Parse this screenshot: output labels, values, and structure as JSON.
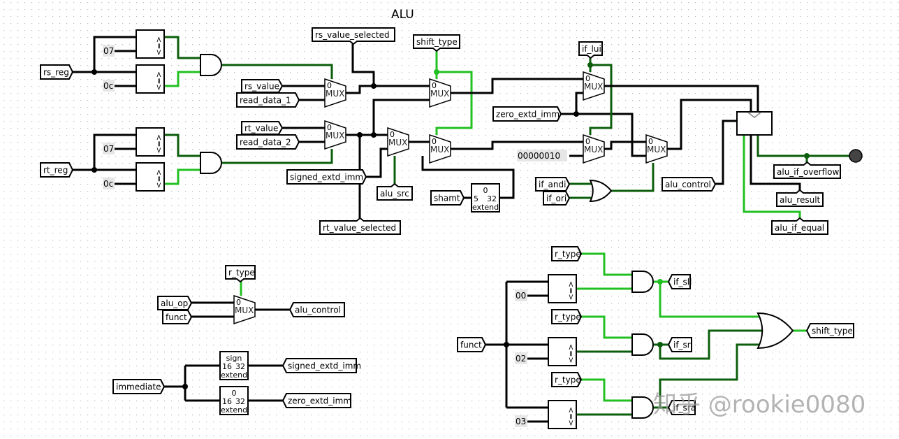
{
  "title": "ALU",
  "labels": {
    "rs_reg": "rs_reg",
    "rt_reg": "rt_reg",
    "rs_value": "rs_value",
    "read_data_1": "read_data_1",
    "rt_value": "rt_value",
    "read_data_2": "read_data_2",
    "rs_value_selected": "rs_value_selected",
    "rt_value_selected": "rt_value_selected",
    "shift_type": "shift_type",
    "signed_extd_imm": "signed_extd_imm",
    "alu_src": "alu_src",
    "shamt": "shamt",
    "if_lui": "if_lui",
    "zero_extd_imm": "zero_extd_imm",
    "if_andi": "if_andi",
    "if_ori": "if_ori",
    "alu_control": "alu_control",
    "alu_if_overflow": "alu_if_overflow",
    "alu_result": "alu_result",
    "alu_if_equal": "alu_if_equal",
    "r_type": "r_type",
    "alu_op": "alu_op",
    "funct": "funct",
    "immediate": "immediate",
    "if_sll": "if_sll",
    "if_srl": "if_srl",
    "if_sra": "if_sra"
  },
  "constants": {
    "c07": "07",
    "c0c": "0c",
    "c00": "00",
    "c02": "02",
    "c03": "03",
    "c10": "00000010"
  },
  "components": {
    "mux": "MUX",
    "mux_sel": "0",
    "comparator": "<=>",
    "extend": "extend",
    "sign": "sign",
    "zero": "0",
    "w16": "16",
    "w32": "32",
    "w5": "5"
  },
  "colors": {
    "wire": "#000000",
    "wire_low": "#0b5e0b",
    "wire_high": "#22c022",
    "led": "#444444",
    "grid_dot": "#b8b8b8"
  },
  "watermark": "知乎 @rookie0080"
}
